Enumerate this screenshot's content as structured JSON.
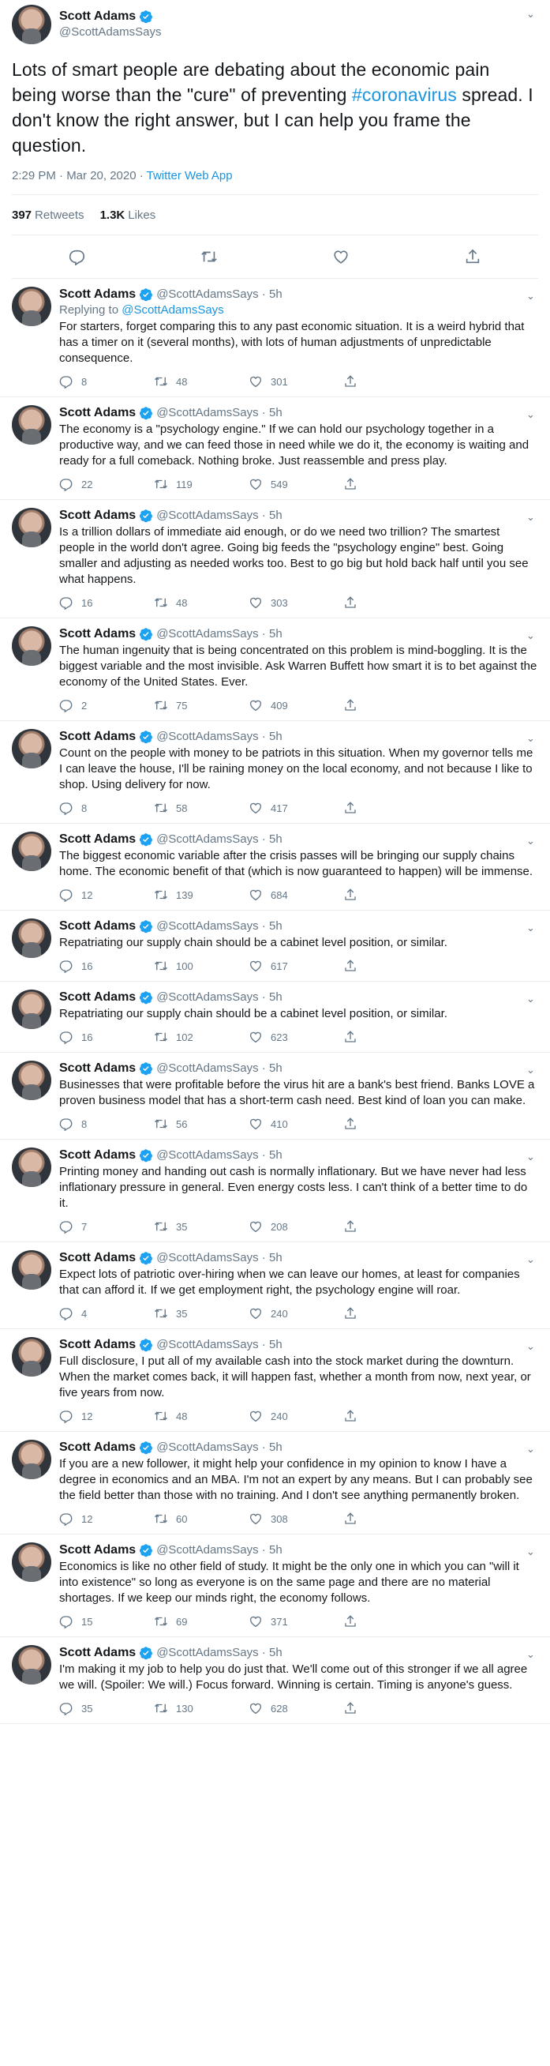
{
  "main": {
    "name": "Scott Adams",
    "handle": "@ScottAdamsSays",
    "text_before": "Lots of smart people are debating about the economic pain being worse than the \"cure\" of preventing ",
    "hashtag": "#coronavirus",
    "text_after": " spread. I don't know the right answer, but I can help you frame the question.",
    "time": "2:29 PM · Mar 20, 2020 · ",
    "app": "Twitter Web App",
    "retweets_count": "397",
    "retweets_label": "Retweets",
    "likes_count": "1.3K",
    "likes_label": "Likes"
  },
  "replies": [
    {
      "name": "Scott Adams",
      "handle": "@ScottAdamsSays · 5h",
      "replying_label": "Replying to ",
      "replying_to": "@ScottAdamsSays",
      "text": "For starters, forget comparing this to any past economic situation. It is a weird hybrid that has a timer on it (several months), with lots of human adjustments of unpredictable consequence.",
      "replies": "8",
      "retweets": "48",
      "likes": "301"
    },
    {
      "name": "Scott Adams",
      "handle": "@ScottAdamsSays · 5h",
      "text": "The economy is a \"psychology engine.\" If we can hold our psychology together in a productive way, and we can feed those in need while we do it, the economy is waiting and ready for a full comeback. Nothing broke. Just reassemble and press play.",
      "replies": "22",
      "retweets": "119",
      "likes": "549"
    },
    {
      "name": "Scott Adams",
      "handle": "@ScottAdamsSays · 5h",
      "text": "Is a trillion dollars of immediate aid enough, or do we need two trillion? The smartest people in the world don't agree. Going big feeds the \"psychology engine\" best. Going smaller and adjusting as needed works too. Best to go big but hold back half until you see what happens.",
      "replies": "16",
      "retweets": "48",
      "likes": "303"
    },
    {
      "name": "Scott Adams",
      "handle": "@ScottAdamsSays · 5h",
      "text": "The human ingenuity that is being concentrated on this problem is mind-boggling. It is the biggest variable and the most invisible. Ask Warren Buffett how smart it is to bet against the economy of the United States. Ever.",
      "replies": "2",
      "retweets": "75",
      "likes": "409"
    },
    {
      "name": "Scott Adams",
      "handle": "@ScottAdamsSays · 5h",
      "text": "Count on the people with money to be patriots in this situation. When my governor tells me I can leave the house, I'll be raining money on the local economy, and not because I like to shop. Using delivery for now.",
      "replies": "8",
      "retweets": "58",
      "likes": "417"
    },
    {
      "name": "Scott Adams",
      "handle": "@ScottAdamsSays · 5h",
      "text": "The biggest economic variable after the crisis passes will be bringing our supply chains home. The economic benefit of that (which is now guaranteed to happen) will be immense.",
      "replies": "12",
      "retweets": "139",
      "likes": "684"
    },
    {
      "name": "Scott Adams",
      "handle": "@ScottAdamsSays · 5h",
      "text": "Repatriating our supply chain should be a cabinet level position, or similar.",
      "replies": "16",
      "retweets": "100",
      "likes": "617"
    },
    {
      "name": "Scott Adams",
      "handle": "@ScottAdamsSays · 5h",
      "text": "Repatriating our supply chain should be a cabinet level position, or similar.",
      "replies": "16",
      "retweets": "102",
      "likes": "623"
    },
    {
      "name": "Scott Adams",
      "handle": "@ScottAdamsSays · 5h",
      "text": "Businesses that were profitable before the virus hit are a bank's best friend. Banks LOVE a proven business model that has a short-term cash need. Best kind of loan you can make.",
      "replies": "8",
      "retweets": "56",
      "likes": "410"
    },
    {
      "name": "Scott Adams",
      "handle": "@ScottAdamsSays · 5h",
      "text": "Printing money and handing out cash is normally inflationary. But we have never had less inflationary pressure in general. Even energy costs less. I can't think of a better time to do it.",
      "replies": "7",
      "retweets": "35",
      "likes": "208"
    },
    {
      "name": "Scott Adams",
      "handle": "@ScottAdamsSays · 5h",
      "text": "Expect lots of patriotic over-hiring when we can leave our homes, at least for companies that can afford it. If we get employment right, the psychology engine will roar.",
      "replies": "4",
      "retweets": "35",
      "likes": "240"
    },
    {
      "name": "Scott Adams",
      "handle": "@ScottAdamsSays · 5h",
      "text": "Full disclosure, I put all of my available cash into the stock market during the downturn. When the market comes back, it will happen fast, whether a month from now, next year, or five years from now.",
      "replies": "12",
      "retweets": "48",
      "likes": "240"
    },
    {
      "name": "Scott Adams",
      "handle": "@ScottAdamsSays · 5h",
      "text": "If you are a new follower, it might help your confidence in my opinion to know I have a degree in economics and an MBA. I'm not an expert by any means. But I can probably see the field better than those with no training. And I don't see anything permanently broken.",
      "replies": "12",
      "retweets": "60",
      "likes": "308"
    },
    {
      "name": "Scott Adams",
      "handle": "@ScottAdamsSays · 5h",
      "text": "Economics is like no other field of study. It might be the only one in which you can \"will it into existence\" so long as everyone is on the same page and there are no material shortages. If we keep our minds right, the economy follows.",
      "replies": "15",
      "retweets": "69",
      "likes": "371"
    },
    {
      "name": "Scott Adams",
      "handle": "@ScottAdamsSays · 5h",
      "text": "I'm making it my job to help you do just that. We'll come out of this stronger if we all agree we will. (Spoiler: We will.) Focus forward. Winning is certain. Timing is anyone's guess.",
      "replies": "35",
      "retweets": "130",
      "likes": "628"
    }
  ]
}
